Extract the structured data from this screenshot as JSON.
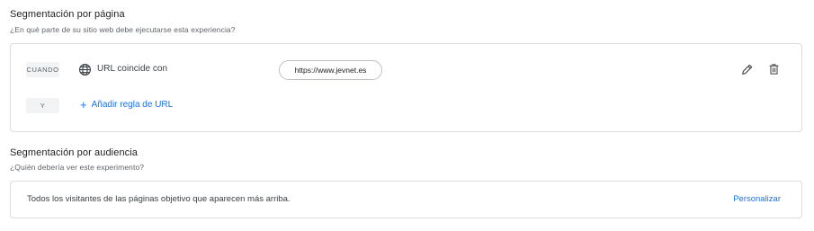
{
  "page_segmentation": {
    "title": "Segmentación por página",
    "subtitle": "¿En qué parte de su sitio web debe ejecutarse esta experiencia?",
    "when_chip": "CUANDO",
    "condition_label": "URL coincide con",
    "url_value": "https://www.jevnet.es",
    "and_chip": "Y",
    "add_rule_label": "Añadir regla de URL",
    "icons": {
      "globe": "globe-icon",
      "edit": "pencil-icon",
      "delete": "trash-icon",
      "add": "plus-icon"
    }
  },
  "audience_segmentation": {
    "title": "Segmentación por audiencia",
    "subtitle": "¿Quién debería ver este experimento?",
    "description": "Todos los visitantes de las páginas objetivo que aparecen más arriba.",
    "customize_label": "Personalizar"
  },
  "colors": {
    "accent": "#1a73e8",
    "border": "#dadce0",
    "chip_bg": "#f1f3f4",
    "text_secondary": "#5f6368"
  }
}
